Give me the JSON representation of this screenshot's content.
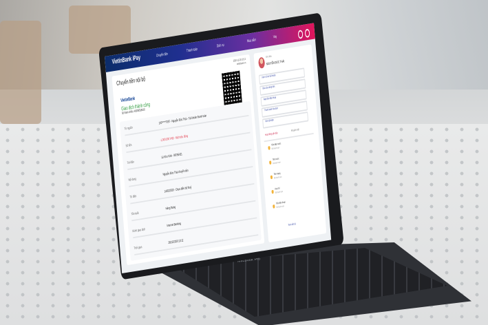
{
  "device_label": "MacBook Pro",
  "app": {
    "brand": "VietinBank iPay",
    "nav": [
      "Chuyển tiền",
      "Thanh toán",
      "Dịch vụ",
      "Mua sắm",
      "Vay"
    ]
  },
  "receipt": {
    "title": "Chuyển tiền nội bộ",
    "timestamp_lines": [
      "2020-12-28 10:12",
      "vietinbank.vn"
    ],
    "bank_logo": "VietinBank",
    "status": "Giao dịch thành công",
    "reference": "Số tham chiếu: 40009536016",
    "rows": [
      {
        "label": "Từ nguồn",
        "value": "100*****7097 - Nguyễn Đức Thái - Tài khoản thanh toán"
      },
      {
        "label": "Số tiền",
        "value": "-1,000,000 VND · Một triệu đồng",
        "negative": true
      },
      {
        "label": "Tới điện",
        "value": "Lê Khu Vinh - 98756421"
      },
      {
        "label": "Nội dung",
        "value": "Nguyễn Đức Thái chuyển tiền"
      },
      {
        "label": "Từ điện",
        "value": "14/03/2020 - Chưa điền bộ thuỷ"
      },
      {
        "label": "Tần suất",
        "value": "Hàng tháng"
      },
      {
        "label": "Kênh giao dịch",
        "value": "Internet Banking"
      },
      {
        "label": "Thời gian",
        "value": "28/12/2020 10:12"
      }
    ]
  },
  "sidebar": {
    "greeting": "Xin chào",
    "user_name": "NGUYỄN ĐỨC THÁI",
    "items": [
      "Xem số dư tài khoản",
      "Báo cáo dòng tiền",
      "Nạp tiền điện thoại",
      "Thanh toán hóa đơn",
      "Gửi tiết kiệm"
    ],
    "tabs": [
      "Hoạt động gần đây",
      "Khuyến mãi"
    ],
    "notifications": [
      {
        "title": "Tiền điện nước",
        "sub": "Đã thanh toán"
      },
      {
        "title": "Tiền nước",
        "sub": "Đã thanh toán"
      },
      {
        "title": "Tiền mạng",
        "sub": "Đã thanh toán"
      },
      {
        "title": "Học phí",
        "sub": "Đã thanh toán"
      },
      {
        "title": "Tiền điện thoại",
        "sub": "Đã thanh toán"
      }
    ],
    "see_all": "Xem tất cả"
  },
  "colors": {
    "topbar_start": "#0c2d6b",
    "topbar_end": "#e1155b",
    "success": "#2e9a3d",
    "negative": "#e23a4b"
  }
}
